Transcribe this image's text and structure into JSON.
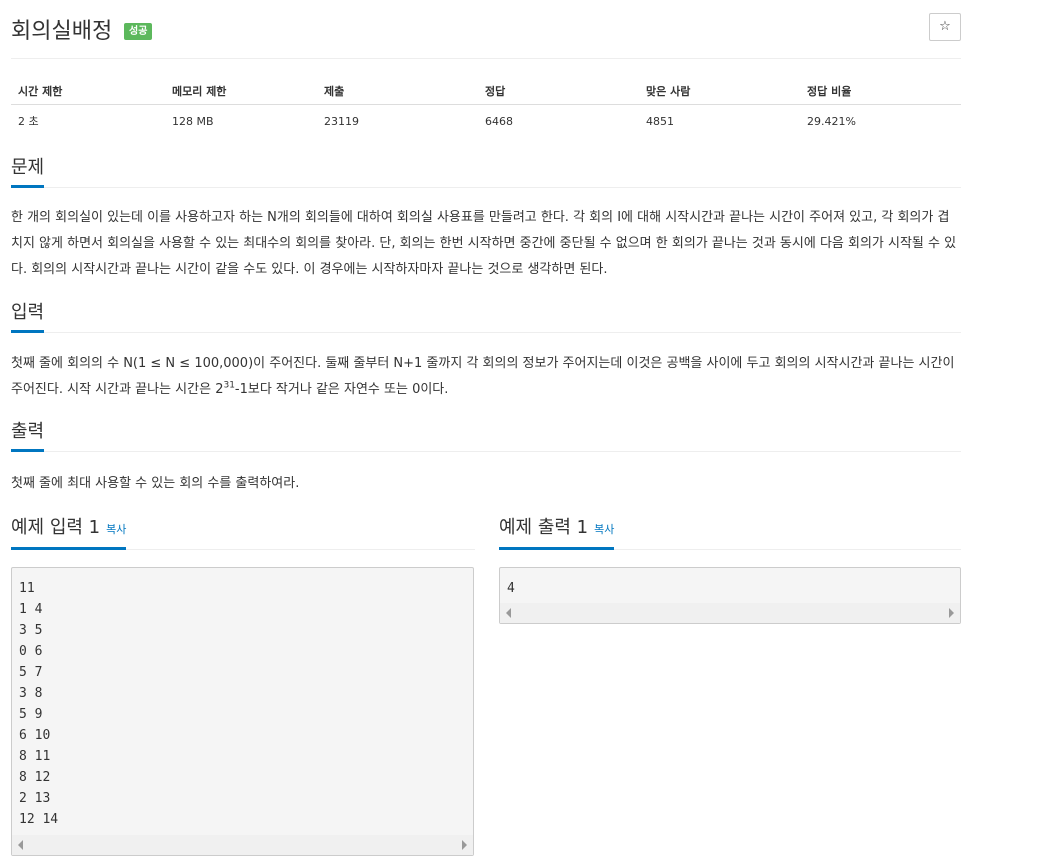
{
  "problem": {
    "title": "회의실배정",
    "status_badge": "성공",
    "star_icon": "☆"
  },
  "stats": {
    "headers": [
      "시간 제한",
      "메모리 제한",
      "제출",
      "정답",
      "맞은 사람",
      "정답 비율"
    ],
    "values": [
      "2 초",
      "128 MB",
      "23119",
      "6468",
      "4851",
      "29.421%"
    ]
  },
  "sections": {
    "problem": {
      "heading": "문제",
      "text": "한 개의 회의실이 있는데 이를 사용하고자 하는 N개의 회의들에 대하여 회의실 사용표를 만들려고 한다. 각 회의 I에 대해 시작시간과 끝나는 시간이 주어져 있고, 각 회의가 겹치지 않게 하면서 회의실을 사용할 수 있는 최대수의 회의를 찾아라. 단, 회의는 한번 시작하면 중간에 중단될 수 없으며 한 회의가 끝나는 것과 동시에 다음 회의가 시작될 수 있다. 회의의 시작시간과 끝나는 시간이 같을 수도 있다. 이 경우에는 시작하자마자 끝나는 것으로 생각하면 된다."
    },
    "input": {
      "heading": "입력",
      "text_before_sup": "첫째 줄에 회의의 수 N(1 ≤ N ≤ 100,000)이 주어진다. 둘째 줄부터 N+1 줄까지 각 회의의 정보가 주어지는데 이것은 공백을 사이에 두고 회의의 시작시간과 끝나는 시간이 주어진다. 시작 시간과 끝나는 시간은 2",
      "sup": "31",
      "text_after_sup": "-1보다 작거나 같은 자연수 또는 0이다."
    },
    "output": {
      "heading": "출력",
      "text": "첫째 줄에 최대 사용할 수 있는 회의 수를 출력하여라."
    }
  },
  "samples": {
    "input": {
      "heading": "예제 입력 1",
      "copy_label": "복사",
      "lines": [
        "11",
        "1 4",
        "3 5",
        "0 6",
        "5 7",
        "3 8",
        "5 9",
        "6 10",
        "8 11",
        "8 12",
        "2 13",
        "12 14"
      ]
    },
    "output": {
      "heading": "예제 출력 1",
      "copy_label": "복사",
      "lines": [
        "4"
      ]
    }
  }
}
